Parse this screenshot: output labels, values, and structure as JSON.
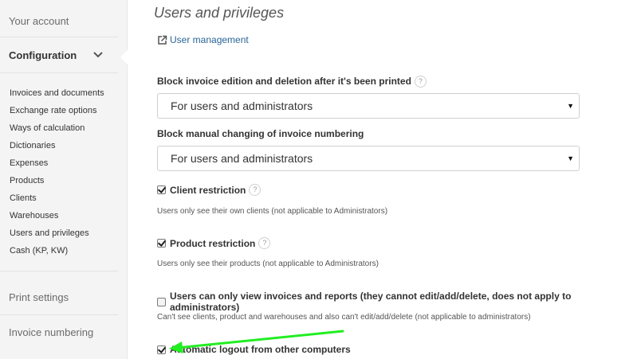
{
  "sidebar": {
    "your_account": "Your account",
    "configuration": "Configuration",
    "items": [
      {
        "label": "Invoices and documents"
      },
      {
        "label": "Exchange rate options"
      },
      {
        "label": "Ways of calculation"
      },
      {
        "label": "Dictionaries"
      },
      {
        "label": "Expenses"
      },
      {
        "label": "Products"
      },
      {
        "label": "Clients"
      },
      {
        "label": "Warehouses"
      },
      {
        "label": "Users and privileges"
      },
      {
        "label": "Cash (KP, KW)"
      }
    ],
    "print_settings": "Print settings",
    "invoice_numbering": "Invoice numbering"
  },
  "main": {
    "title": "Users and privileges",
    "user_management_link": "User management",
    "block_edit": {
      "label": "Block invoice edition and deletion after it's been printed",
      "value": "For users and administrators"
    },
    "block_numbering": {
      "label": "Block manual changing of invoice numbering",
      "value": "For users and administrators"
    },
    "client_restriction": {
      "label": "Client restriction",
      "checked": true,
      "desc": "Users only see their own clients (not applicable to Administrators)"
    },
    "product_restriction": {
      "label": "Product restriction",
      "checked": true,
      "desc": "Users only see their products (not applicable to Administrators)"
    },
    "view_only": {
      "label": "Users can only view invoices and reports (they cannot edit/add/delete, does not apply to administrators)",
      "checked": false,
      "desc": "Can't see clients, product and warehouses and also can't edit/add/delete (not applicable to administrators)"
    },
    "auto_logout": {
      "label": "Automatic logout from other computers",
      "checked": true
    },
    "help_glyph": "?",
    "caret_glyph": "▼"
  },
  "colors": {
    "annotation_arrow": "#22ee22",
    "link": "#2a6496"
  }
}
